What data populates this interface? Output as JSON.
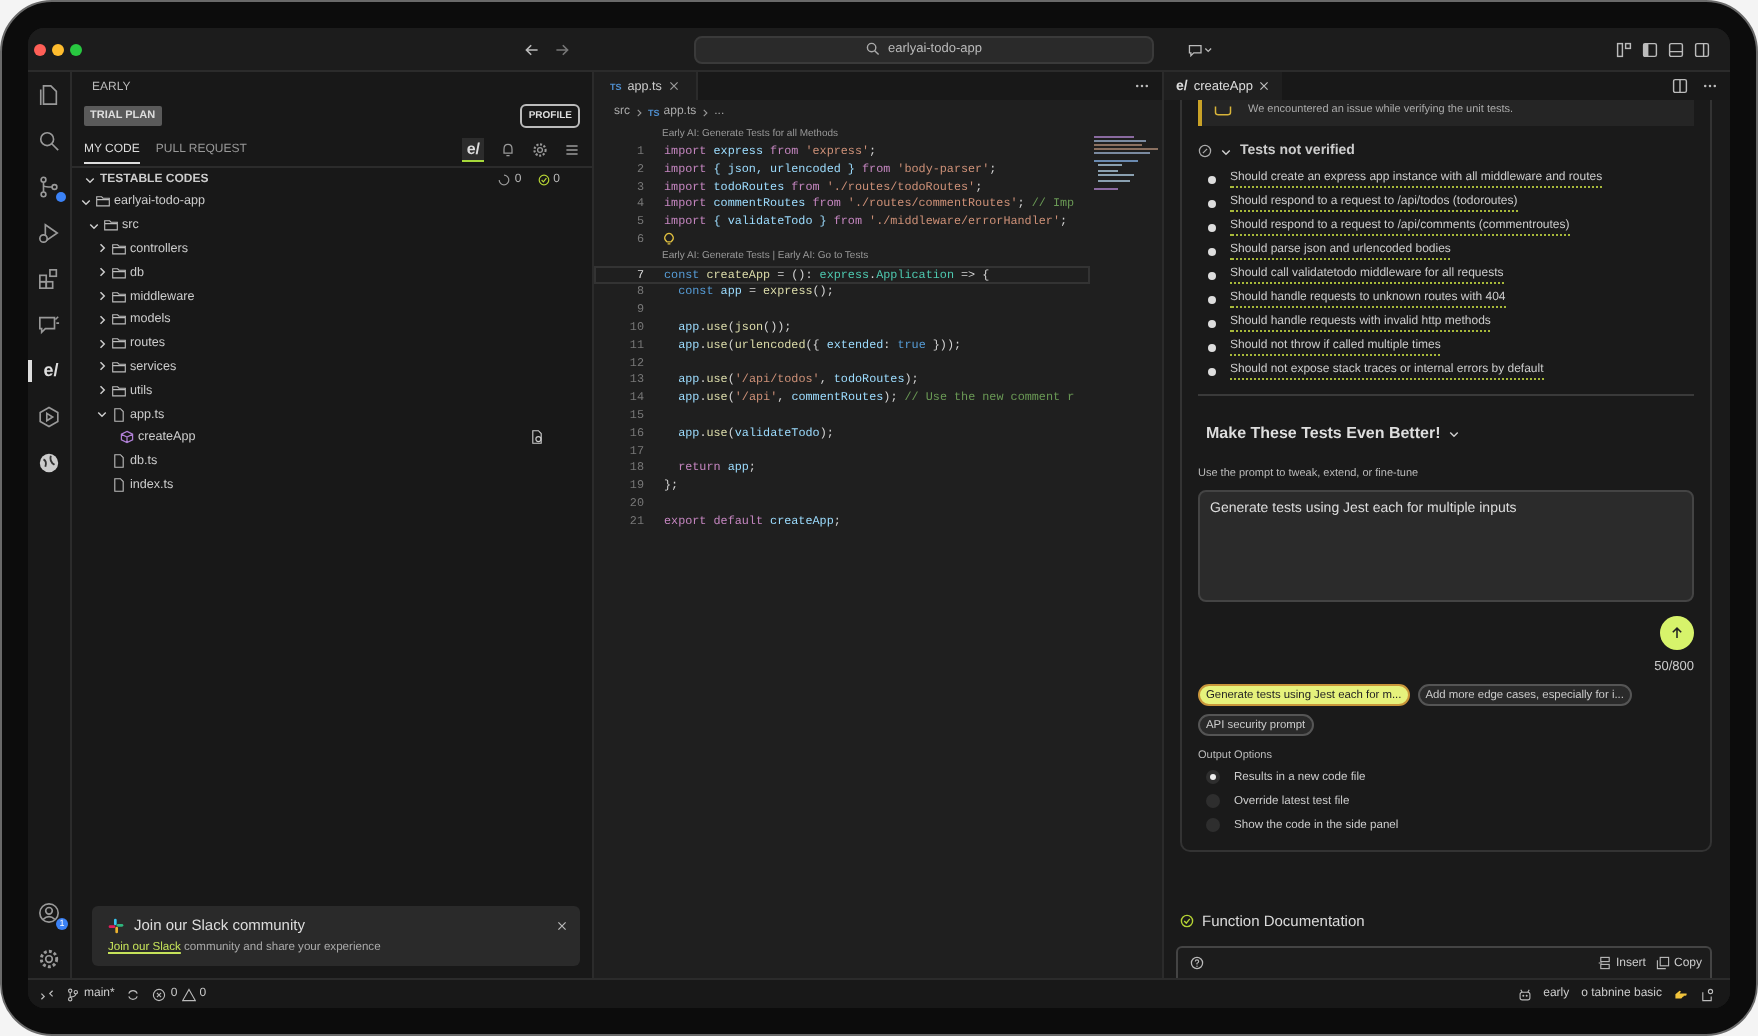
{
  "title_bar": {
    "search": "earlyai-todo-app"
  },
  "activity_bar": {
    "logo_text": "e/",
    "account_badge": "1"
  },
  "sidebar": {
    "title": "EARLY",
    "plan_badge": "TRIAL PLAN",
    "profile_button": "PROFILE",
    "tabs": [
      {
        "label": "MY CODE",
        "selected": true
      },
      {
        "label": "PULL REQUEST",
        "selected": false
      }
    ],
    "view_logo": "e/",
    "section": {
      "title": "TESTABLE CODES",
      "expanded": true,
      "pending_count": "0",
      "passed_count": "0"
    },
    "tree": [
      {
        "label": "earlyai-todo-app",
        "kind": "folder",
        "expanded": true,
        "children": [
          {
            "label": "src",
            "kind": "folder",
            "expanded": true,
            "children": [
              {
                "label": "controllers",
                "kind": "folder",
                "expanded": false
              },
              {
                "label": "db",
                "kind": "folder",
                "expanded": false
              },
              {
                "label": "middleware",
                "kind": "folder",
                "expanded": false
              },
              {
                "label": "models",
                "kind": "folder",
                "expanded": false
              },
              {
                "label": "routes",
                "kind": "folder",
                "expanded": false
              },
              {
                "label": "services",
                "kind": "folder",
                "expanded": false
              },
              {
                "label": "utils",
                "kind": "folder",
                "expanded": false
              },
              {
                "label": "app.ts",
                "kind": "file",
                "expanded": true,
                "children": [
                  {
                    "label": "createApp",
                    "kind": "method"
                  }
                ]
              },
              {
                "label": "db.ts",
                "kind": "file"
              },
              {
                "label": "index.ts",
                "kind": "file"
              }
            ]
          }
        ]
      }
    ],
    "toast": {
      "title": "Join our Slack community",
      "link": "Join our Slack",
      "text": " community and share your experience"
    }
  },
  "editor": {
    "tab": "app.ts",
    "tab_icon_text": "TS",
    "breadcrumb_icon_text": "TS",
    "breadcrumb": [
      "src",
      "app.ts",
      "..."
    ],
    "lines": [
      {
        "number": "1",
        "current": false,
        "lightbulb": false,
        "lens": "Early AI: Generate Tests for all Methods",
        "tokens": [
          {
            "text": "import",
            "kind": "keyword"
          },
          {
            "text": " express ",
            "kind": "variable"
          },
          {
            "text": "from",
            "kind": "keyword"
          },
          {
            "text": " 'express'",
            "kind": "string"
          },
          {
            "text": ";",
            "kind": "punct"
          }
        ]
      },
      {
        "number": "2",
        "current": false,
        "lightbulb": false,
        "tokens": [
          {
            "text": "import",
            "kind": "keyword"
          },
          {
            "text": " { json, urlencoded } ",
            "kind": "variable"
          },
          {
            "text": "from",
            "kind": "keyword"
          },
          {
            "text": " 'body-parser'",
            "kind": "string"
          },
          {
            "text": ";",
            "kind": "punct"
          }
        ]
      },
      {
        "number": "3",
        "current": false,
        "lightbulb": false,
        "tokens": [
          {
            "text": "import",
            "kind": "keyword"
          },
          {
            "text": " todoRoutes ",
            "kind": "variable"
          },
          {
            "text": "from",
            "kind": "keyword"
          },
          {
            "text": " './routes/todoRoutes'",
            "kind": "string"
          },
          {
            "text": ";",
            "kind": "punct"
          }
        ]
      },
      {
        "number": "4",
        "current": false,
        "lightbulb": false,
        "tokens": [
          {
            "text": "import",
            "kind": "keyword"
          },
          {
            "text": " commentRoutes ",
            "kind": "variable"
          },
          {
            "text": "from",
            "kind": "keyword"
          },
          {
            "text": " './routes/commentRoutes'",
            "kind": "string"
          },
          {
            "text": "; ",
            "kind": "punct"
          },
          {
            "text": "// Imp",
            "kind": "comment"
          }
        ]
      },
      {
        "number": "5",
        "current": false,
        "lightbulb": false,
        "tokens": [
          {
            "text": "import",
            "kind": "keyword"
          },
          {
            "text": " { validateTodo } ",
            "kind": "variable"
          },
          {
            "text": "from",
            "kind": "keyword"
          },
          {
            "text": " './middleware/errorHandler'",
            "kind": "string"
          },
          {
            "text": ";",
            "kind": "punct"
          }
        ]
      },
      {
        "number": "6",
        "current": false,
        "lightbulb": true
      },
      {
        "number": "7",
        "current": true,
        "lightbulb": false,
        "lens": "Early AI: Generate Tests | Early AI: Go to Tests",
        "tokens": [
          {
            "text": "const",
            "kind": "declaration"
          },
          {
            "text": " createApp ",
            "kind": "function"
          },
          {
            "text": "= (): ",
            "kind": "punct"
          },
          {
            "text": "express",
            "kind": "type"
          },
          {
            "text": ".",
            "kind": "punct"
          },
          {
            "text": "Application",
            "kind": "type"
          },
          {
            "text": " => {",
            "kind": "punct"
          }
        ]
      },
      {
        "number": "8",
        "current": false,
        "lightbulb": false,
        "tokens": [
          {
            "text": "  const",
            "kind": "declaration"
          },
          {
            "text": " app ",
            "kind": "variable"
          },
          {
            "text": "= ",
            "kind": "punct"
          },
          {
            "text": "express",
            "kind": "function"
          },
          {
            "text": "();",
            "kind": "punct"
          }
        ]
      },
      {
        "number": "9",
        "current": false,
        "lightbulb": false
      },
      {
        "number": "10",
        "current": false,
        "lightbulb": false,
        "tokens": [
          {
            "text": "  app",
            "kind": "variable"
          },
          {
            "text": ".",
            "kind": "punct"
          },
          {
            "text": "use",
            "kind": "function"
          },
          {
            "text": "(",
            "kind": "punct"
          },
          {
            "text": "json",
            "kind": "function"
          },
          {
            "text": "());",
            "kind": "punct"
          }
        ]
      },
      {
        "number": "11",
        "current": false,
        "lightbulb": false,
        "tokens": [
          {
            "text": "  app",
            "kind": "variable"
          },
          {
            "text": ".",
            "kind": "punct"
          },
          {
            "text": "use",
            "kind": "function"
          },
          {
            "text": "(",
            "kind": "punct"
          },
          {
            "text": "urlencoded",
            "kind": "function"
          },
          {
            "text": "({ ",
            "kind": "punct"
          },
          {
            "text": "extended",
            "kind": "variable"
          },
          {
            "text": ": ",
            "kind": "punct"
          },
          {
            "text": "true",
            "kind": "declaration"
          },
          {
            "text": " }));",
            "kind": "punct"
          }
        ]
      },
      {
        "number": "12",
        "current": false,
        "lightbulb": false
      },
      {
        "number": "13",
        "current": false,
        "lightbulb": false,
        "tokens": [
          {
            "text": "  app",
            "kind": "variable"
          },
          {
            "text": ".",
            "kind": "punct"
          },
          {
            "text": "use",
            "kind": "function"
          },
          {
            "text": "(",
            "kind": "punct"
          },
          {
            "text": "'/api/todos'",
            "kind": "string"
          },
          {
            "text": ", ",
            "kind": "punct"
          },
          {
            "text": "todoRoutes",
            "kind": "variable"
          },
          {
            "text": ");",
            "kind": "punct"
          }
        ]
      },
      {
        "number": "14",
        "current": false,
        "lightbulb": false,
        "tokens": [
          {
            "text": "  app",
            "kind": "variable"
          },
          {
            "text": ".",
            "kind": "punct"
          },
          {
            "text": "use",
            "kind": "function"
          },
          {
            "text": "(",
            "kind": "punct"
          },
          {
            "text": "'/api'",
            "kind": "string"
          },
          {
            "text": ", ",
            "kind": "punct"
          },
          {
            "text": "commentRoutes",
            "kind": "variable"
          },
          {
            "text": "); ",
            "kind": "punct"
          },
          {
            "text": "// Use the new comment r",
            "kind": "comment"
          }
        ]
      },
      {
        "number": "15",
        "current": false,
        "lightbulb": false
      },
      {
        "number": "16",
        "current": false,
        "lightbulb": false,
        "tokens": [
          {
            "text": "  app",
            "kind": "variable"
          },
          {
            "text": ".",
            "kind": "punct"
          },
          {
            "text": "use",
            "kind": "function"
          },
          {
            "text": "(",
            "kind": "punct"
          },
          {
            "text": "validateTodo",
            "kind": "variable"
          },
          {
            "text": ");",
            "kind": "punct"
          }
        ]
      },
      {
        "number": "17",
        "current": false,
        "lightbulb": false
      },
      {
        "number": "18",
        "current": false,
        "lightbulb": false,
        "tokens": [
          {
            "text": "  return",
            "kind": "keyword"
          },
          {
            "text": " app",
            "kind": "variable"
          },
          {
            "text": ";",
            "kind": "punct"
          }
        ]
      },
      {
        "number": "19",
        "current": false,
        "lightbulb": false,
        "tokens": [
          {
            "text": "};",
            "kind": "punct"
          }
        ]
      },
      {
        "number": "20",
        "current": false,
        "lightbulb": false
      },
      {
        "number": "21",
        "current": false,
        "lightbulb": false,
        "tokens": [
          {
            "text": "export default",
            "kind": "keyword"
          },
          {
            "text": " createApp",
            "kind": "variable"
          },
          {
            "text": ";",
            "kind": "punct"
          }
        ]
      }
    ]
  },
  "panel": {
    "tab": "createApp",
    "tab_logo": "e/",
    "warning": "We encountered an issue while verifying the unit tests.",
    "tests_header": {
      "title": "Tests not verified",
      "expanded": true
    },
    "tests": [
      "Should create an express app instance with all middleware and routes",
      "Should respond to a request to /api/todos (todoroutes)",
      "Should respond to a request to /api/comments (commentroutes)",
      "Should parse json and urlencoded bodies",
      "Should call validatetodo middleware for all requests",
      "Should handle requests to unknown routes with 404",
      "Should handle requests with invalid http methods",
      "Should not throw if called multiple times",
      "Should not expose stack traces or internal errors by default"
    ],
    "improve": {
      "title": "Make These Tests Even Better!",
      "expanded": true,
      "hint": "Use the prompt to tweak, extend, or fine-tune",
      "prompt": "Generate tests using Jest each for multiple inputs",
      "counter": "50/800",
      "suggestions": [
        {
          "label": "Generate tests using Jest each for m...",
          "selected": true
        },
        {
          "label": "Add more edge cases, especially for i...",
          "selected": false
        },
        {
          "label": "API security prompt",
          "selected": false
        }
      ],
      "output_label": "Output Options",
      "options": [
        {
          "label": "Results in a new code file",
          "selected": true
        },
        {
          "label": "Override latest test file",
          "selected": false
        },
        {
          "label": "Show the code in the side panel",
          "selected": false
        }
      ]
    },
    "doc_section": "Function Documentation",
    "actions": [
      "Insert",
      "Copy"
    ]
  },
  "status_bar": {
    "branch": "main*",
    "errors": "0",
    "warnings": "0",
    "account": "early",
    "plan": "o tabnine basic"
  }
}
